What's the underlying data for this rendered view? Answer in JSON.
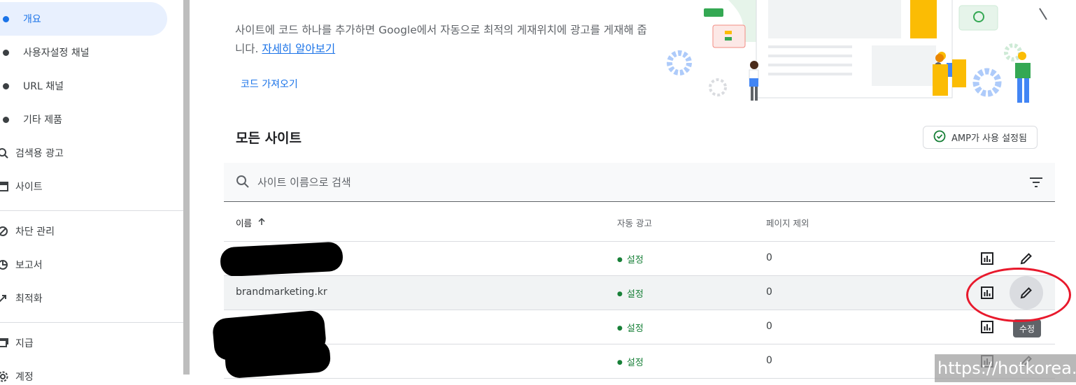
{
  "sidebar": {
    "items": [
      {
        "label": "개요",
        "kind": "sub",
        "active": true
      },
      {
        "label": "사용자설정 채널",
        "kind": "sub"
      },
      {
        "label": "URL 채널",
        "kind": "sub"
      },
      {
        "label": "기타 제품",
        "kind": "sub"
      },
      {
        "label": "검색용 광고",
        "kind": "top",
        "icon": "search-ads-icon"
      },
      {
        "label": "사이트",
        "kind": "top",
        "icon": "sites-icon"
      },
      {
        "label": "차단 관리",
        "kind": "top",
        "icon": "block-icon"
      },
      {
        "label": "보고서",
        "kind": "top",
        "icon": "reports-icon"
      },
      {
        "label": "최적화",
        "kind": "top",
        "icon": "optimize-icon"
      },
      {
        "label": "지급",
        "kind": "top",
        "icon": "payments-icon"
      },
      {
        "label": "계정",
        "kind": "top",
        "icon": "settings-icon"
      }
    ]
  },
  "intro": {
    "text": "사이트에 코드 하나를 추가하면 Google에서 자동으로 최적의 게재위치에 광고를 게재해 줍니다.",
    "link": "자세히 알아보기",
    "get_code": "코드 가져오기"
  },
  "sites": {
    "title": "모든 사이트",
    "amp_chip": "AMP가 사용 설정됨",
    "search_placeholder": "사이트 이름으로 검색",
    "columns": {
      "name": "이름",
      "auto_ads": "자동 광고",
      "page_exclusions": "페이지 제외"
    },
    "rows": [
      {
        "name": "",
        "status": "설정",
        "exclusions": "0"
      },
      {
        "name": "brandmarketing.kr",
        "status": "설정",
        "exclusions": "0"
      },
      {
        "name": "",
        "status": "설정",
        "exclusions": "0"
      },
      {
        "name": "",
        "status": "설정",
        "exclusions": "0"
      }
    ],
    "tooltip": "수정"
  },
  "watermark": "https://hotkorea.kr",
  "colors": {
    "accent": "#1a73e8",
    "status_green": "#188038",
    "annotation_red": "#e8192c"
  }
}
